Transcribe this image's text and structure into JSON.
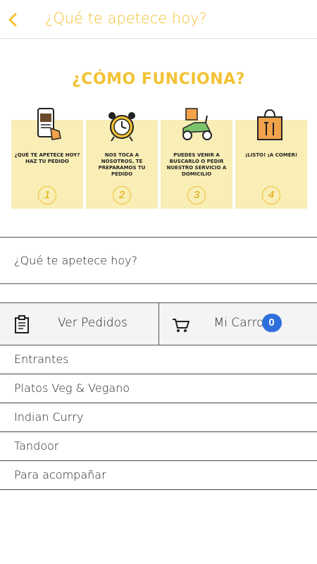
{
  "header": {
    "title": "¿Qué te apetece hoy?"
  },
  "banner": {
    "title": "¿CÓMO FUNCIONA?",
    "steps": [
      {
        "text": "¿QUÉ TE APETECE HOY? HAZ TU PEDIDO",
        "number": "1",
        "icon": "phone-order-icon"
      },
      {
        "text": "NOS TOCA A NOSOTROS, TE PREPARAMOS TU PEDIDO",
        "number": "2",
        "icon": "alarm-clock-icon"
      },
      {
        "text": "PUEDES VENIR A BUSCARLO O PEDIR NUESTRO SERVICIO A DOMICILIO",
        "number": "3",
        "icon": "delivery-scooter-icon"
      },
      {
        "text": "¡LISTO! ¡A COMER!",
        "number": "4",
        "icon": "food-bag-icon"
      }
    ]
  },
  "section": {
    "label": "¿Qué te apetece hoy?"
  },
  "actions": {
    "orders_label": "Ver Pedidos",
    "cart_label": "Mi Carro",
    "cart_count": "0"
  },
  "menu": [
    {
      "label": "Entrantes"
    },
    {
      "label": "Platos Veg & Vegano"
    },
    {
      "label": "Indian Curry"
    },
    {
      "label": "Tandoor"
    },
    {
      "label": "Para acompañar"
    }
  ],
  "colors": {
    "accent": "#f2c233",
    "card_bg": "#f8eeb6",
    "badge": "#2f6fdd"
  }
}
